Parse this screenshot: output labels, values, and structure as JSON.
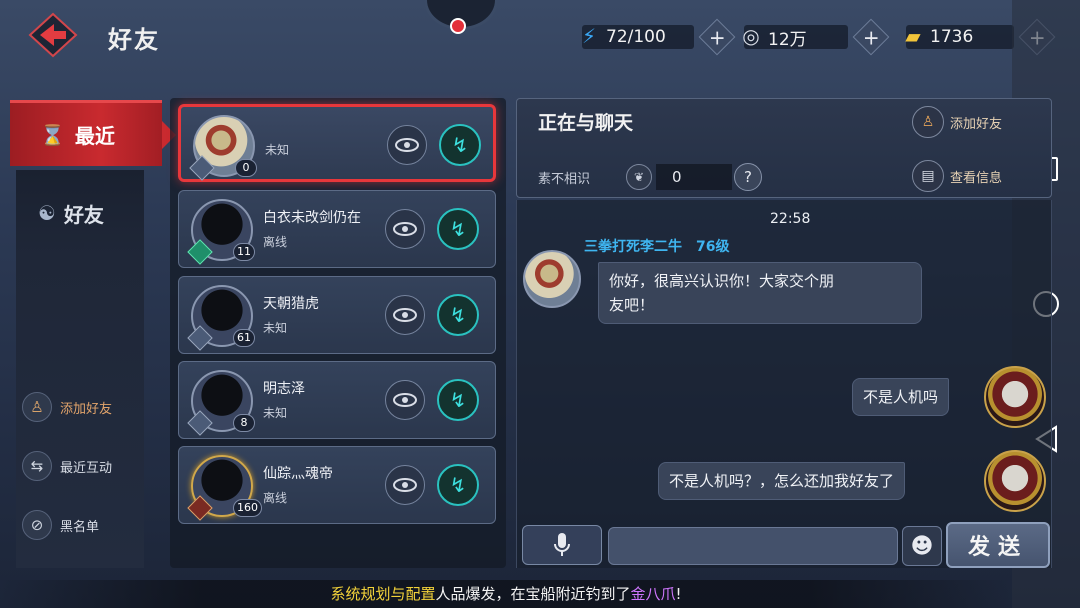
{
  "header": {
    "title": "好友",
    "energy": "72/100",
    "coins": "12万",
    "gold": "1736"
  },
  "tabs": {
    "recent": "最近",
    "friends": "好友"
  },
  "side_links": {
    "add_friend": "添加好友",
    "recent_interaction": "最近互动",
    "blacklist": "黑名单"
  },
  "friends": [
    {
      "name": "",
      "status": "未知",
      "level": "0"
    },
    {
      "name": "白衣未改剑仍在",
      "status": "离线",
      "level": "11"
    },
    {
      "name": "天朝猎虎",
      "status": "未知",
      "level": "61"
    },
    {
      "name": "明志泽",
      "status": "未知",
      "level": "8"
    },
    {
      "name": "仙踪灬魂帝",
      "status": "离线",
      "level": "160"
    }
  ],
  "chat": {
    "title": "正在与聊天",
    "add_friend": "添加好友",
    "view_info": "查看信息",
    "relation_label": "素不相识",
    "relation_value": "0",
    "help": "?",
    "time": "22:58",
    "sender": "三拳打死李二牛　76级",
    "messages": [
      {
        "from": "other",
        "text_line1": "你好，很高兴认识你！大家交个朋",
        "text_line2": "友吧！"
      },
      {
        "from": "me",
        "text": "不是人机吗"
      },
      {
        "from": "me",
        "text": "不是人机吗？，怎么还加我好友了"
      }
    ],
    "send": "发送"
  },
  "ticker": {
    "part1": "系统规划与配置",
    "part2": "人品爆发，在宝船附近钓到了",
    "part3": "金八爪",
    "part4": "!"
  },
  "colors": {
    "accent_red": "#c92a2f",
    "chat_cyan": "#2ac2c0",
    "sender_blue": "#3fb5f0",
    "ticker_yellow": "#f2d23a",
    "ticker_purple": "#cf77ff"
  }
}
